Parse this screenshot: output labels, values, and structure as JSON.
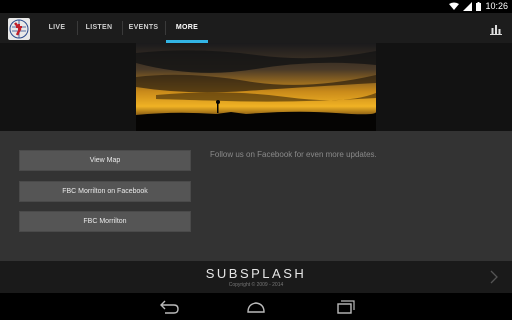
{
  "status_bar": {
    "time": "10:26"
  },
  "tabs": [
    {
      "label": "LIVE"
    },
    {
      "label": "LISTEN"
    },
    {
      "label": "EVENTS"
    },
    {
      "label": "MORE",
      "selected": true
    }
  ],
  "colors": {
    "accent": "#33b5e5",
    "button_bg": "#555555",
    "content_bg": "#333333"
  },
  "buttons": [
    {
      "label": "View Map"
    },
    {
      "label": "FBC Morrilton on Facebook"
    },
    {
      "label": "FBC Morrilton"
    }
  ],
  "follow_text": "Follow us on Facebook for even more updates.",
  "footer": {
    "brand": "SUBSPLASH",
    "copyright": "Copyright © 2009 - 2014"
  },
  "icons": {
    "logo": "church-logo-icon",
    "stats": "bar-chart-icon",
    "next": "chevron-right-icon",
    "back": "back-icon",
    "home": "home-icon",
    "recent": "recent-apps-icon"
  }
}
